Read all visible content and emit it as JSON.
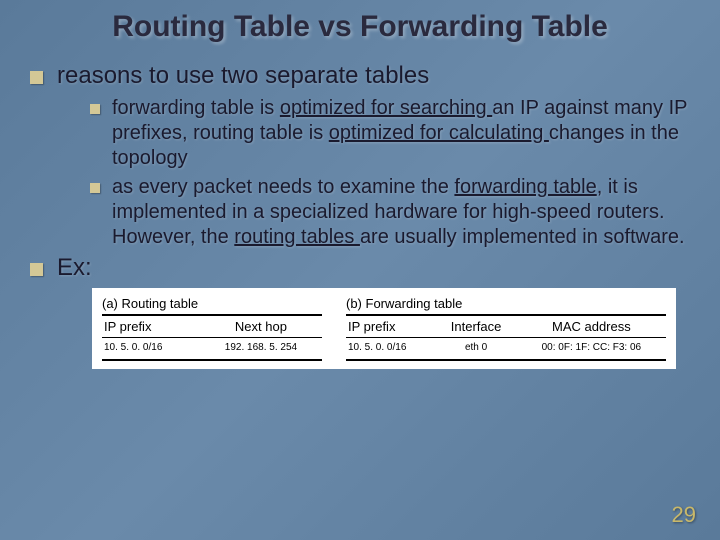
{
  "title": "Routing Table vs Forwarding Table",
  "bullets": {
    "b1": "reasons to use two separate tables",
    "b1_1_a": "forwarding table is ",
    "b1_1_b": "optimized for searching ",
    "b1_1_c": "an IP against many IP prefixes, routing table is ",
    "b1_1_d": "optimized for calculating ",
    "b1_1_e": "changes in the topology",
    "b1_2_a": "as every packet needs to examine the ",
    "b1_2_b": "forwarding table",
    "b1_2_c": ", it is implemented in a specialized hardware for high-speed routers. However, the ",
    "b1_2_d": "routing tables ",
    "b1_2_e": "are usually implemented in software.",
    "b2": "Ex:"
  },
  "tables": {
    "a": {
      "caption": "(a) Routing table",
      "headers": [
        "IP prefix",
        "Next hop"
      ],
      "row": [
        "10. 5. 0. 0/16",
        "192. 168. 5. 254"
      ]
    },
    "b": {
      "caption": "(b) Forwarding table",
      "headers": [
        "IP prefix",
        "Interface",
        "MAC address"
      ],
      "row": [
        "10. 5. 0. 0/16",
        "eth 0",
        "00: 0F: 1F: CC: F3: 06"
      ]
    }
  },
  "page_number": "29"
}
